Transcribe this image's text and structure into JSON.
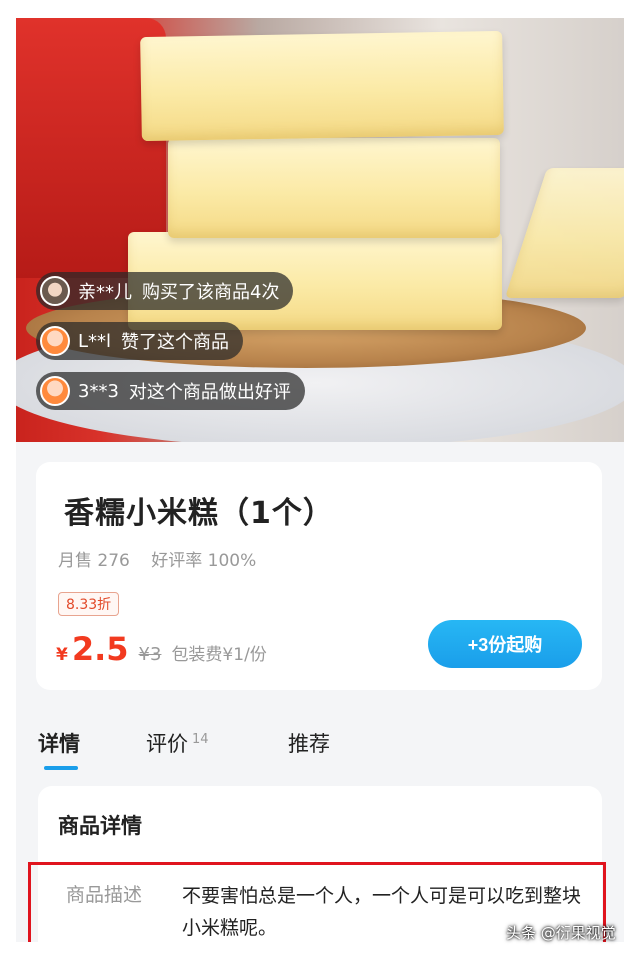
{
  "activity": [
    {
      "user": "亲**儿",
      "action": "购买了该商品4次"
    },
    {
      "user": "L**l",
      "action": "赞了这个商品"
    },
    {
      "user": "3**3",
      "action": "对这个商品做出好评"
    }
  ],
  "product": {
    "title": "香糯小米糕（1个）",
    "monthly_sales": "月售 276",
    "rating": "好评率 100%",
    "discount": "8.33折",
    "currency": "¥",
    "price": "2.5",
    "original_price": "¥3",
    "packaging_fee": "包装费¥1/份",
    "buy_button": "+3份起购"
  },
  "tabs": [
    {
      "label": "详情",
      "active": true
    },
    {
      "label": "评价",
      "count": "14"
    },
    {
      "label": "推荐"
    }
  ],
  "details": {
    "title": "商品详情",
    "desc_label": "商品描述",
    "desc_text": "不要害怕总是一个人，一个人可是可以吃到整块小米糕呢。"
  },
  "watermark": "头条 @衍果视觉",
  "colors": {
    "accent": "#1a9eea",
    "price": "#f23a1f",
    "highlight": "#e0141e"
  }
}
